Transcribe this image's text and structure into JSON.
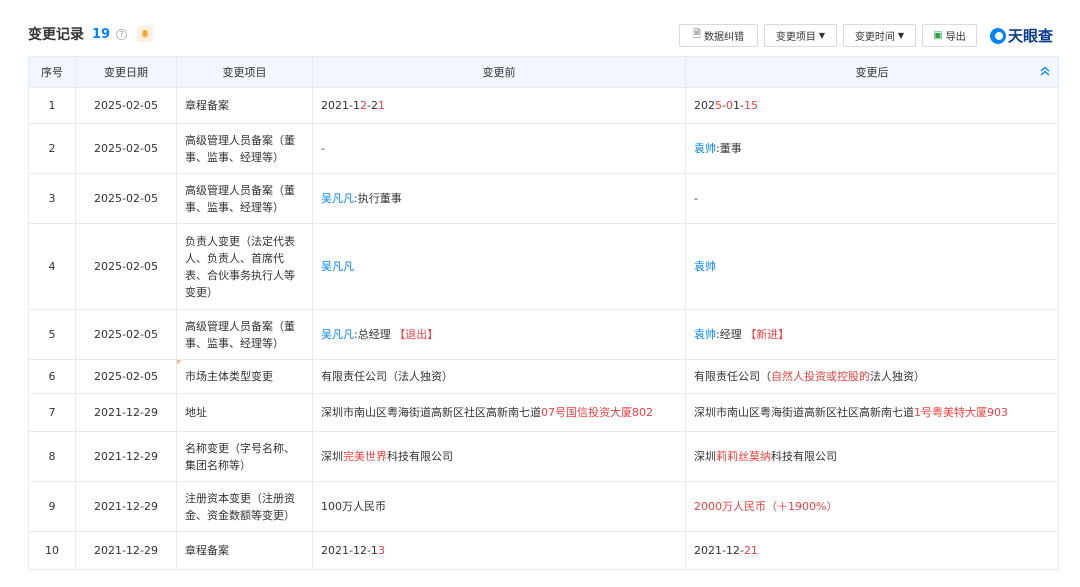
{
  "header": {
    "title": "变更记录",
    "count": "19",
    "help": "?",
    "toolbar": {
      "report_label": "数据纠错",
      "item_label": "变更项目",
      "time_label": "变更时间",
      "export_label": "导出",
      "logo": "天眼查"
    }
  },
  "table": {
    "headers": {
      "seq": "序号",
      "date": "变更日期",
      "item": "变更项目",
      "before": "变更前",
      "after": "变更后"
    },
    "rows": [
      {
        "seq": "1",
        "date": "2025-02-05",
        "item": "章程备案",
        "before": [
          {
            "t": "2021-1"
          },
          {
            "t": "2",
            "c": "red"
          },
          {
            "t": "-2"
          },
          {
            "t": "1",
            "c": "red"
          }
        ],
        "after": [
          {
            "t": "202"
          },
          {
            "t": "5",
            "c": "red"
          },
          {
            "t": "-"
          },
          {
            "t": "0",
            "c": "red"
          },
          {
            "t": "1-"
          },
          {
            "t": "15",
            "c": "red"
          }
        ]
      },
      {
        "seq": "2",
        "date": "2025-02-05",
        "item": "高级管理人员备案（董事、监事、经理等）",
        "before": [
          {
            "t": "-"
          }
        ],
        "after": [
          {
            "t": "袁帅",
            "c": "blue"
          },
          {
            "t": ":董事"
          }
        ]
      },
      {
        "seq": "3",
        "date": "2025-02-05",
        "item": "高级管理人员备案（董事、监事、经理等）",
        "before": [
          {
            "t": "吴凡凡",
            "c": "blue"
          },
          {
            "t": ":执行董事"
          }
        ],
        "after": [
          {
            "t": "-"
          }
        ]
      },
      {
        "seq": "4",
        "date": "2025-02-05",
        "item": "负责人变更（法定代表人、负责人、首席代表、合伙事务执行人等变更）",
        "before": [
          {
            "t": "吴凡凡",
            "c": "blue"
          }
        ],
        "after": [
          {
            "t": "袁帅",
            "c": "blue"
          }
        ]
      },
      {
        "seq": "5",
        "date": "2025-02-05",
        "item": "高级管理人员备案（董事、监事、经理等）",
        "before": [
          {
            "t": "吴凡凡",
            "c": "blue"
          },
          {
            "t": ":总经理 "
          },
          {
            "t": "【退出】",
            "c": "red"
          }
        ],
        "after": [
          {
            "t": "袁帅",
            "c": "blue"
          },
          {
            "t": ":经理 "
          },
          {
            "t": "【新进】",
            "c": "red"
          }
        ]
      },
      {
        "seq": "6",
        "date": "2025-02-05",
        "item": "市场主体类型变更",
        "before": [
          {
            "t": "有限责任公司（法人独资）"
          }
        ],
        "after": [
          {
            "t": "有限责任公司（"
          },
          {
            "t": "自然人投资或控股的",
            "c": "red"
          },
          {
            "t": "法人独资）"
          }
        ]
      },
      {
        "seq": "7",
        "date": "2021-12-29",
        "item": "地址",
        "before": [
          {
            "t": "深圳市南山区粤海街道高新区社区高新南七道"
          },
          {
            "t": "07号国信投资大厦802",
            "c": "red"
          }
        ],
        "after": [
          {
            "t": "深圳市南山区粤海街道高新区社区高新南七道"
          },
          {
            "t": "1号粤美特大厦903",
            "c": "red"
          }
        ]
      },
      {
        "seq": "8",
        "date": "2021-12-29",
        "item": "名称变更（字号名称、集团名称等）",
        "before": [
          {
            "t": "深圳"
          },
          {
            "t": "完美世界",
            "c": "red"
          },
          {
            "t": "科技有限公司"
          }
        ],
        "after": [
          {
            "t": "深圳"
          },
          {
            "t": "莉莉丝莫纳",
            "c": "red"
          },
          {
            "t": "科技有限公司"
          }
        ]
      },
      {
        "seq": "9",
        "date": "2021-12-29",
        "item": "注册资本变更（注册资金、资金数额等变更）",
        "before": [
          {
            "t": "100万人民币"
          }
        ],
        "after": [
          {
            "t": "2000万人民币（＋1900%）",
            "c": "red"
          }
        ]
      },
      {
        "seq": "10",
        "date": "2021-12-29",
        "item": "章程备案",
        "before": [
          {
            "t": "2021-12-1"
          },
          {
            "t": "3",
            "c": "red"
          }
        ],
        "after": [
          {
            "t": "2021-12-"
          },
          {
            "t": "21",
            "c": "red"
          }
        ]
      }
    ]
  }
}
